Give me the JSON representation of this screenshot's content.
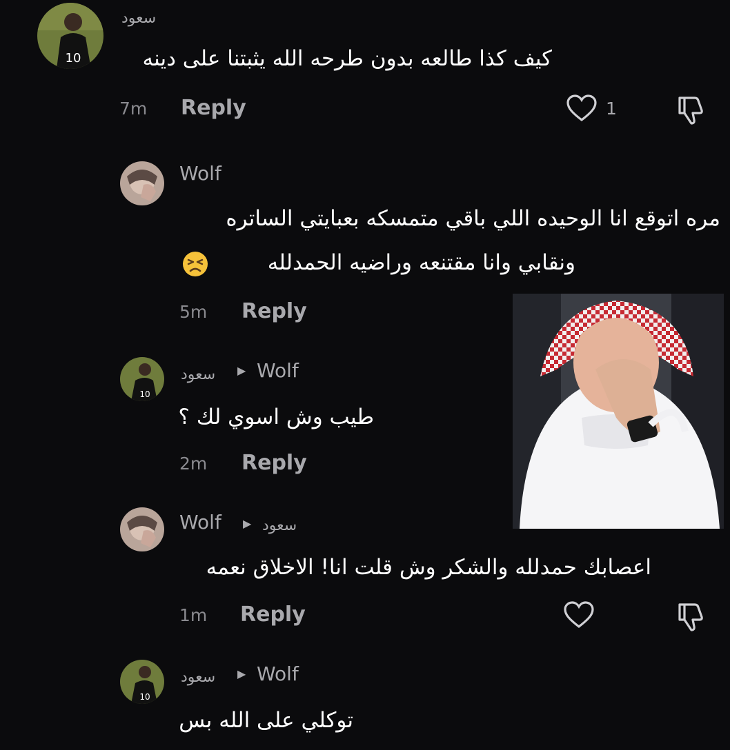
{
  "comments": [
    {
      "username": "سعود",
      "text": "كيف كذا طالعه بدون طرحه الله يثبتنا على دينه",
      "time": "7m",
      "reply_label": "Reply",
      "likes": "1"
    },
    {
      "username": "Wolf",
      "text_line1": "مره اتوقع انا الوحيده اللي باقي متمسكه بعبايتي الساتره",
      "text_line2": "ونقابي وانا مقتنعه وراضيه الحمدلله",
      "time": "5m",
      "reply_label": "Reply"
    },
    {
      "username": "سعود",
      "reply_to": "Wolf",
      "text": "طيب وش اسوي لك ؟",
      "time": "2m",
      "reply_label": "Reply"
    },
    {
      "username": "Wolf",
      "reply_to": "سعود",
      "text": "اعصابك حمدلله والشكر وش قلت انا! الاخلاق نعمه",
      "time": "1m",
      "reply_label": "Reply"
    },
    {
      "username": "سعود",
      "reply_to": "Wolf",
      "text": "توكلي على الله بس"
    }
  ],
  "icons": {
    "like": "heart-icon",
    "dislike": "thumbs-down-icon",
    "reply_arrow": "caret-right-icon",
    "emoji": "persevering-face-emoji"
  },
  "colors": {
    "background": "#0b0b0d",
    "primary_text": "#ffffff",
    "secondary_text": "#a9a9ad"
  }
}
